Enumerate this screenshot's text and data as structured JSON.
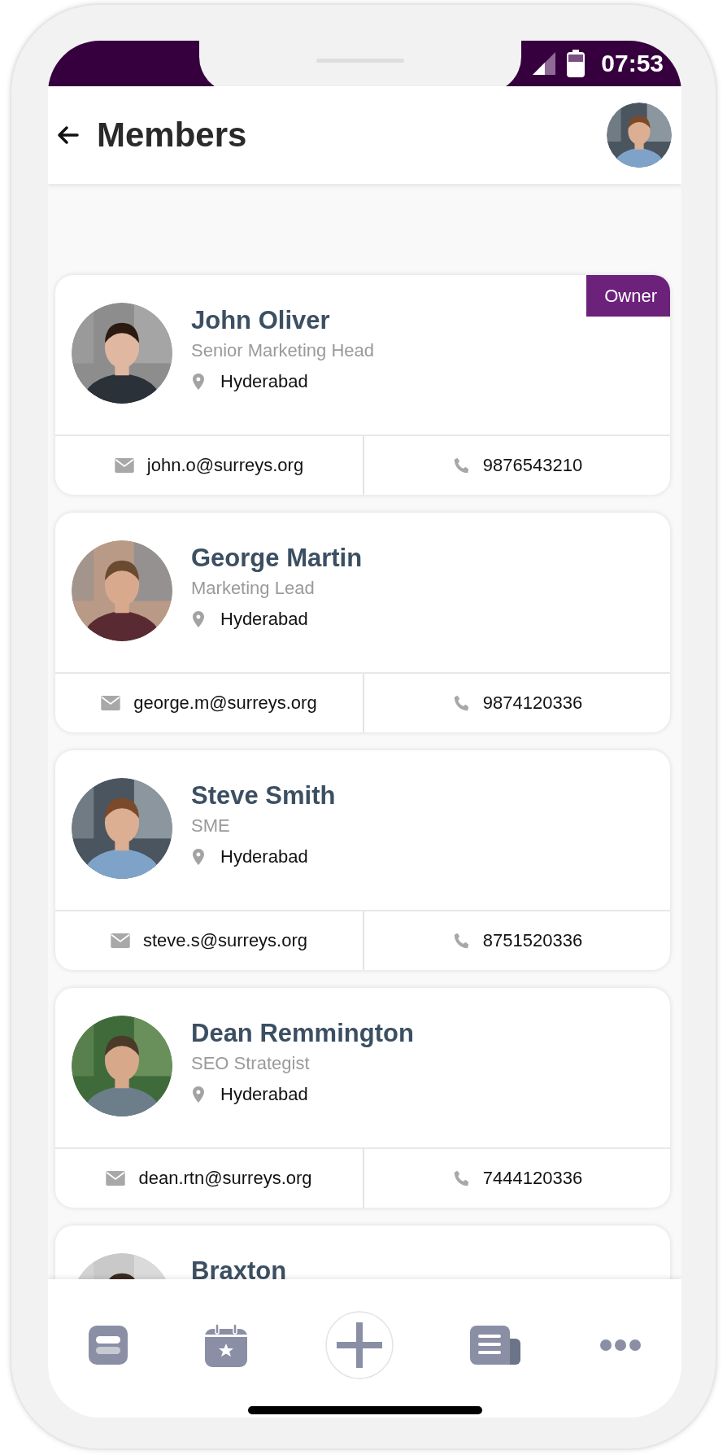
{
  "status_bar": {
    "time": "07:53"
  },
  "header": {
    "title": "Members"
  },
  "members": [
    {
      "name": "John Oliver",
      "role": "Senior Marketing Head",
      "location": "Hyderabad",
      "email": "john.o@surreys.org",
      "phone": "9876543210",
      "badge": "Owner"
    },
    {
      "name": "George Martin",
      "role": "Marketing Lead",
      "location": "Hyderabad",
      "email": "george.m@surreys.org",
      "phone": "9874120336"
    },
    {
      "name": "Steve Smith",
      "role": "SME",
      "location": "Hyderabad",
      "email": "steve.s@surreys.org",
      "phone": "8751520336"
    },
    {
      "name": "Dean Remmington",
      "role": "SEO Strategist",
      "location": "Hyderabad",
      "email": "dean.rtn@surreys.org",
      "phone": "7444120336"
    },
    {
      "name": "Braxton"
    }
  ],
  "nav": [
    {
      "kind": "cards"
    },
    {
      "kind": "calendar"
    },
    {
      "kind": "add"
    },
    {
      "kind": "documents"
    },
    {
      "kind": "more"
    }
  ]
}
